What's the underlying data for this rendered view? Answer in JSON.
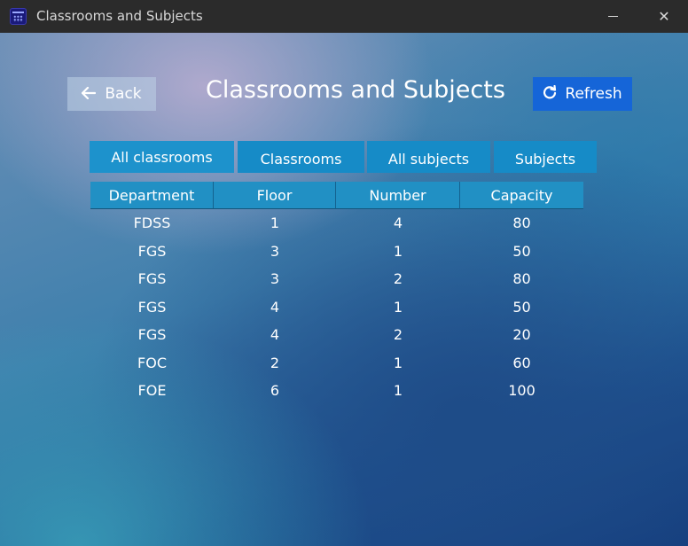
{
  "window": {
    "title": "Classrooms and Subjects",
    "minimize_glyph": "",
    "close_glyph": "✕"
  },
  "header": {
    "back_label": "Back",
    "back_icon": "arrow-left-icon",
    "title": "Classrooms and Subjects",
    "refresh_label": "Refresh",
    "refresh_icon": "refresh-icon"
  },
  "tabs": [
    {
      "label": "All classrooms",
      "active": true
    },
    {
      "label": "Classrooms",
      "active": false
    },
    {
      "label": "All subjects",
      "active": false
    },
    {
      "label": "Subjects",
      "active": false
    }
  ],
  "table": {
    "columns": [
      "Department",
      "Floor",
      "Number",
      "Capacity"
    ],
    "rows": [
      [
        "FDSS",
        "1",
        "4",
        "80"
      ],
      [
        "FGS",
        "3",
        "1",
        "50"
      ],
      [
        "FGS",
        "3",
        "2",
        "80"
      ],
      [
        "FGS",
        "4",
        "1",
        "50"
      ],
      [
        "FGS",
        "4",
        "2",
        "20"
      ],
      [
        "FOC",
        "2",
        "1",
        "60"
      ],
      [
        "FOE",
        "6",
        "1",
        "100"
      ]
    ]
  },
  "colors": {
    "accent_button": "#1565d8",
    "tab_background": "#168bc7",
    "header_background": "#2190c4",
    "titlebar": "#2b2b2b"
  }
}
